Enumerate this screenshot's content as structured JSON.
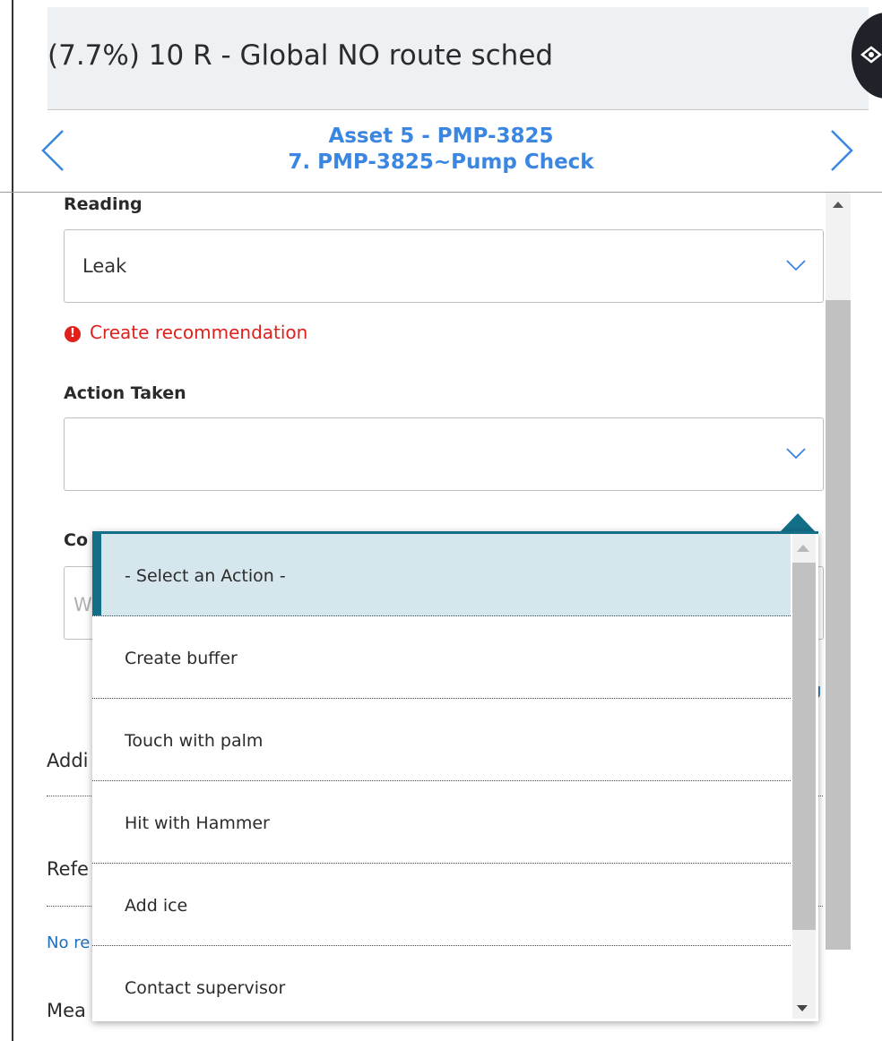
{
  "header": {
    "title": "(7.7%) 10 R - Global NO route sched"
  },
  "fab": {
    "icon": "eye-icon"
  },
  "nav": {
    "asset_title": "Asset 5 - PMP-3825",
    "step_title": "7. PMP-3825~Pump Check",
    "prev_icon": "chevron-left-icon",
    "next_icon": "chevron-right-icon"
  },
  "form": {
    "reading_label": "Reading",
    "reading_value": "Leak",
    "error_text": "Create recommendation",
    "action_label": "Action Taken",
    "action_value": "",
    "comment_label_partial": "Co",
    "comment_placeholder_partial": "W"
  },
  "obscured": {
    "link_partial": "g",
    "additional_partial": "Addi",
    "reference_partial": "Refe",
    "no_results_partial": "No re",
    "measurements_partial": "Mea"
  },
  "dropdown": {
    "selected_index": 0,
    "options": [
      "- Select an Action -",
      "Create buffer",
      "Touch with palm",
      "Hit with Hammer",
      "Add ice",
      "Contact supervisor"
    ]
  },
  "colors": {
    "accent": "#136f87",
    "link": "#3a86e0",
    "error": "#e0201c",
    "selected_bg": "#d5e7ec"
  }
}
